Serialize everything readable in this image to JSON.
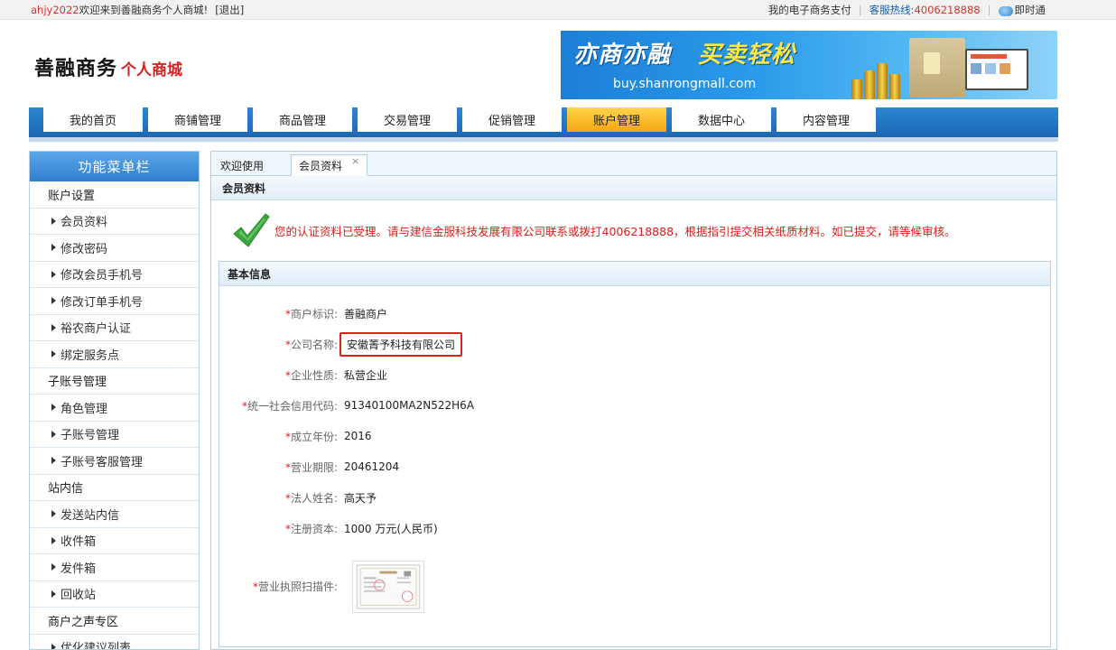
{
  "topbar": {
    "username": "ahjy2022",
    "welcome": "欢迎来到善融商务个人商城!",
    "logout": "[退出]",
    "payment_link": "我的电子商务支付",
    "hotline_label": "客服热线:",
    "hotline_number": "4006218888",
    "im_link": "即时通"
  },
  "header": {
    "logo_main": "善融商务",
    "logo_sub": "个人商城",
    "banner_slogan_1": "亦商亦融",
    "banner_slogan_2": "买卖轻松",
    "banner_url": "buy.shanrongmall.com"
  },
  "nav": {
    "items": [
      {
        "label": "我的首页",
        "active": false
      },
      {
        "label": "商铺管理",
        "active": false
      },
      {
        "label": "商品管理",
        "active": false
      },
      {
        "label": "交易管理",
        "active": false
      },
      {
        "label": "促销管理",
        "active": false
      },
      {
        "label": "账户管理",
        "active": true
      },
      {
        "label": "数据中心",
        "active": false
      },
      {
        "label": "内容管理",
        "active": false
      }
    ]
  },
  "sidebar": {
    "title": "功能菜单栏",
    "rows": [
      {
        "type": "group",
        "label": "账户设置"
      },
      {
        "type": "link",
        "label": "会员资料"
      },
      {
        "type": "link",
        "label": "修改密码"
      },
      {
        "type": "link",
        "label": "修改会员手机号"
      },
      {
        "type": "link",
        "label": "修改订单手机号"
      },
      {
        "type": "link",
        "label": "裕农商户认证"
      },
      {
        "type": "link",
        "label": "绑定服务点"
      },
      {
        "type": "group",
        "label": "子账号管理"
      },
      {
        "type": "link",
        "label": "角色管理"
      },
      {
        "type": "link",
        "label": "子账号管理"
      },
      {
        "type": "link",
        "label": "子账号客服管理"
      },
      {
        "type": "group",
        "label": "站内信"
      },
      {
        "type": "link",
        "label": "发送站内信"
      },
      {
        "type": "link",
        "label": "收件箱"
      },
      {
        "type": "link",
        "label": "发件箱"
      },
      {
        "type": "link",
        "label": "回收站"
      },
      {
        "type": "group",
        "label": "商户之声专区"
      },
      {
        "type": "link",
        "label": "优化建议列表"
      }
    ]
  },
  "tabs": [
    {
      "label": "欢迎使用",
      "active": false
    },
    {
      "label": "会员资料",
      "active": true,
      "close": "×"
    }
  ],
  "content": {
    "section_title": "会员资料",
    "notice": "您的认证资料已受理。请与建信金服科技发展有限公司联系或拨打4006218888，根据指引提交相关纸质材料。如已提交，请等候审核。",
    "basic_info_title": "基本信息",
    "fields": [
      {
        "label": "商户标识:",
        "value": "善融商户"
      },
      {
        "label": "公司名称:",
        "value": "安徽菁予科技有限公司",
        "highlighted": true
      },
      {
        "label": "企业性质:",
        "value": "私营企业"
      },
      {
        "label": "统一社会信用代码:",
        "value": "91340100MA2N522H6A"
      },
      {
        "label": "成立年份:",
        "value": "2016"
      },
      {
        "label": "营业期限:",
        "value": "20461204"
      },
      {
        "label": "法人姓名:",
        "value": "高天予"
      },
      {
        "label": "注册资本:",
        "value": "1000 万元(人民币)"
      },
      {
        "label": "营业执照扫描件:",
        "value": ""
      }
    ],
    "required_mark": "*"
  },
  "colors": {
    "accent_blue": "#2f7fcf",
    "active_tab_orange": "#f5a613",
    "alert_red": "#d6201a",
    "check_green": "#3aa53a"
  }
}
